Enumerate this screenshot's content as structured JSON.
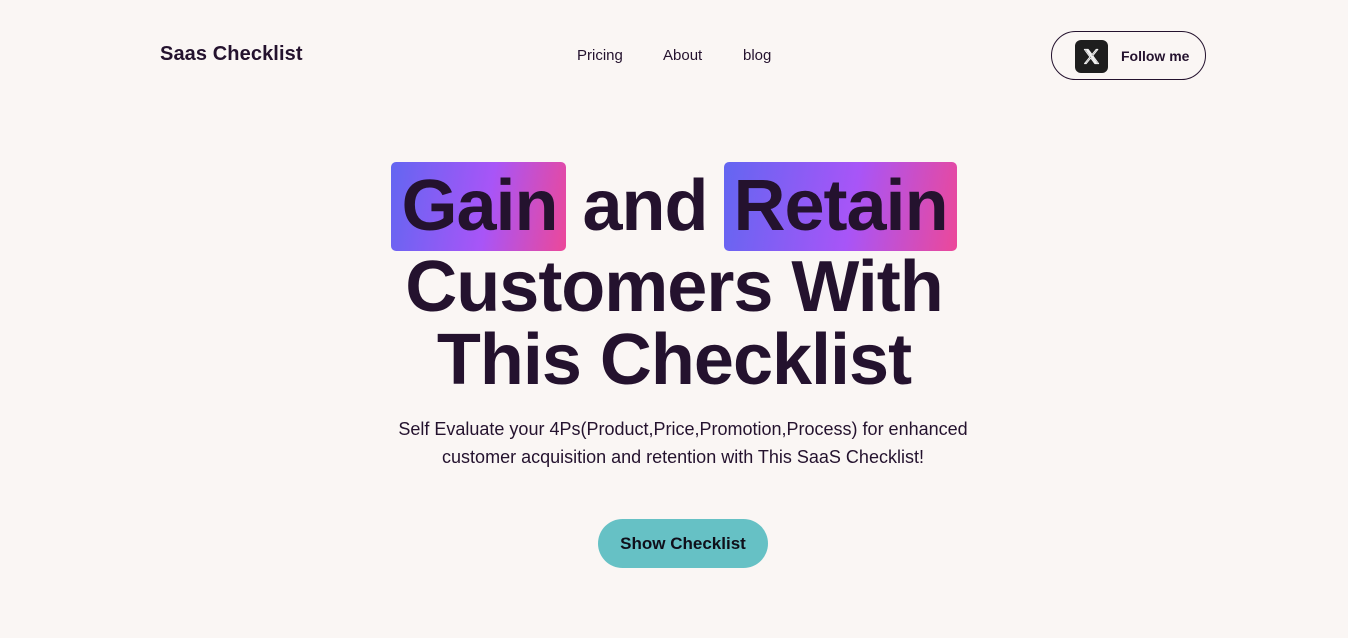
{
  "header": {
    "brand": "Saas Checklist",
    "nav": [
      {
        "label": "Pricing"
      },
      {
        "label": "About"
      },
      {
        "label": "blog"
      }
    ],
    "follow_label": "Follow me",
    "follow_icon": "x-logo-icon"
  },
  "hero": {
    "word_gain": "Gain",
    "word_and": "and",
    "word_retain": "Retain",
    "line2": "Customers With",
    "line3": "This Checklist",
    "subtitle": "Self Evaluate your 4Ps(Product,Price,Promotion,Process) for enhanced customer acquisition and retention with This SaaS Checklist!",
    "cta_label": "Show Checklist"
  },
  "colors": {
    "background": "#faf6f4",
    "text": "#24122e",
    "highlight_gradient": [
      "#6366f1",
      "#a855f7",
      "#ec4899"
    ],
    "cta": "#66c1c5"
  }
}
